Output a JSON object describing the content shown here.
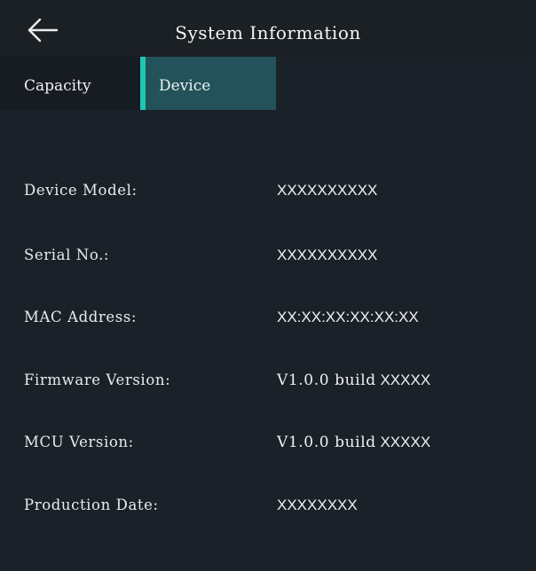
{
  "header": {
    "back_icon": "arrow-left-icon",
    "title": "System Information"
  },
  "tabs": [
    {
      "label": "Capacity",
      "selected": false
    },
    {
      "label": "Device",
      "selected": true
    }
  ],
  "colors": {
    "background": "#1b2128",
    "selected_tab": "#23525a",
    "selected_tab_accent": "#1fc6b7"
  },
  "device_info": {
    "model": {
      "label": "Device Model:",
      "value": "XXXXXXXXXX"
    },
    "serial": {
      "label": "Serial No.:",
      "value": "XXXXXXXXXX"
    },
    "mac": {
      "label": "MAC Address:",
      "value": "XX:XX:XX:XX:XX:XX"
    },
    "firmware": {
      "label": "Firmware Version:",
      "version": "V1.0.0 build",
      "build": "XXXXX"
    },
    "mcu": {
      "label": "MCU Version:",
      "version": "V1.0.0 build",
      "build": "XXXXX"
    },
    "production_date": {
      "label": "Production Date:",
      "value": "XXXXXXXX"
    }
  }
}
